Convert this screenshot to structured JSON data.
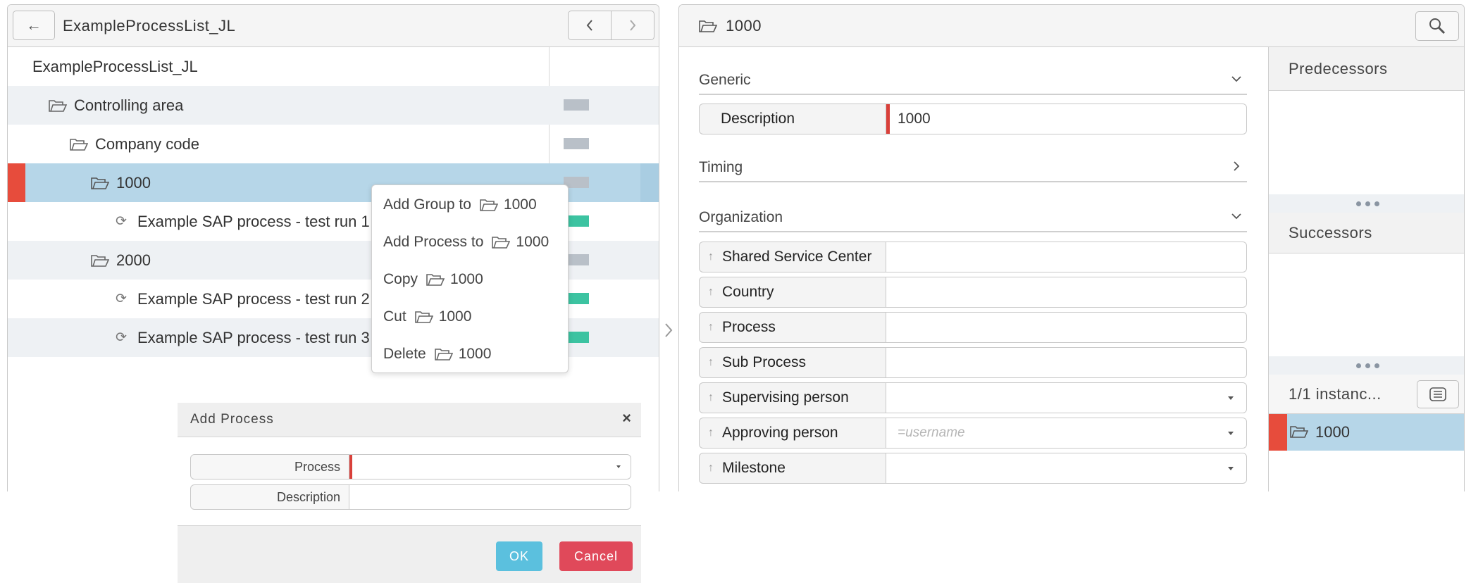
{
  "left_panel": {
    "back_icon": "arrow-left-icon",
    "title": "ExampleProcessList_JL",
    "prev_icon": "chevron-left-icon",
    "next_icon": "chevron-right-icon",
    "tree": [
      {
        "label": "ExampleProcessList_JL",
        "icon": "none",
        "status": "none"
      },
      {
        "label": "Controlling area",
        "icon": "folder-icon",
        "status": "gray"
      },
      {
        "label": "Company code",
        "icon": "folder-icon",
        "status": "gray"
      },
      {
        "label": "1000",
        "icon": "folder-icon",
        "status": "gray",
        "selected": true
      },
      {
        "label": "Example SAP process - test run 1",
        "icon": "process-icon",
        "status": "green"
      },
      {
        "label": "2000",
        "icon": "folder-icon",
        "status": "gray"
      },
      {
        "label": "Example SAP process - test run 2",
        "icon": "process-icon",
        "status": "green"
      },
      {
        "label": "Example SAP process - test run 3",
        "icon": "process-icon",
        "status": "green"
      }
    ],
    "status_colors": {
      "gray": "#b9c0c8",
      "green": "#3cc3a1",
      "error": "#e74c3c"
    }
  },
  "context_menu": {
    "items": [
      {
        "label": "Add Group to",
        "target": "1000"
      },
      {
        "label": "Add Process to",
        "target": "1000"
      },
      {
        "label": "Copy",
        "target": "1000"
      },
      {
        "label": "Cut",
        "target": "1000"
      },
      {
        "label": "Delete",
        "target": "1000"
      }
    ]
  },
  "add_process_dialog": {
    "title": "Add Process",
    "close_icon": "close-icon",
    "process_label": "Process",
    "process_value": "",
    "description_label": "Description",
    "description_value": "",
    "ok_label": "OK",
    "cancel_label": "Cancel",
    "ok_color": "#5bc0de",
    "cancel_color": "#e0495a"
  },
  "right_panel": {
    "title": "1000",
    "search_icon": "search-icon",
    "sections": {
      "generic": "Generic",
      "timing": "Timing",
      "organization": "Organization"
    },
    "description": {
      "label": "Description",
      "value": "1000"
    },
    "org_fields": [
      {
        "label": "Shared Service Center",
        "value": "",
        "dropdown": false
      },
      {
        "label": "Country",
        "value": "",
        "dropdown": false
      },
      {
        "label": "Process",
        "value": "",
        "dropdown": false
      },
      {
        "label": "Sub Process",
        "value": "",
        "dropdown": false
      },
      {
        "label": "Supervising person",
        "value": "",
        "dropdown": true
      },
      {
        "label": "Approving person",
        "value": "",
        "placeholder": "=username",
        "dropdown": true
      },
      {
        "label": "Milestone",
        "value": "",
        "dropdown": true
      }
    ],
    "side": {
      "predecessors": "Predecessors",
      "successors": "Successors",
      "instances_label": "1/1 instanc...",
      "instances_icon": "list-icon",
      "instance_item": "1000"
    }
  }
}
